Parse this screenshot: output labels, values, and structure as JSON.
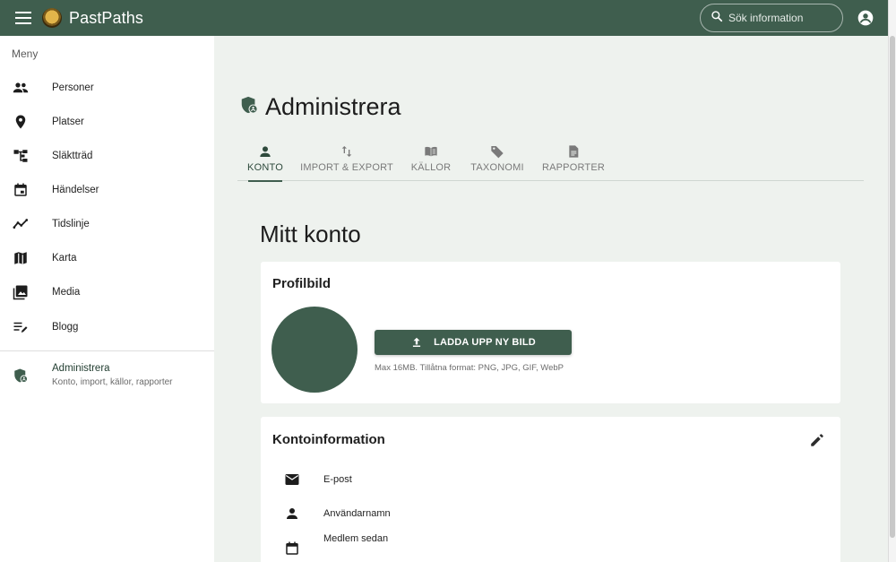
{
  "app": {
    "title": "PastPaths"
  },
  "search": {
    "placeholder": "Sök information"
  },
  "sidebar": {
    "heading": "Meny",
    "items": [
      {
        "label": "Personer",
        "icon": "people-icon"
      },
      {
        "label": "Platser",
        "icon": "location-pin-icon"
      },
      {
        "label": "Släktträd",
        "icon": "family-tree-icon"
      },
      {
        "label": "Händelser",
        "icon": "calendar-icon"
      },
      {
        "label": "Tidslinje",
        "icon": "timeline-icon"
      },
      {
        "label": "Karta",
        "icon": "map-icon"
      },
      {
        "label": "Media",
        "icon": "image-icon"
      },
      {
        "label": "Blogg",
        "icon": "edit-notes-icon"
      }
    ],
    "admin": {
      "label": "Administrera",
      "sublabel": "Konto, import, källor, rapporter",
      "icon": "admin-shield-icon"
    }
  },
  "page": {
    "title": "Administrera"
  },
  "tabs": [
    {
      "label": "KONTO",
      "icon": "person-icon",
      "active": true
    },
    {
      "label": "IMPORT & EXPORT",
      "icon": "import-export-icon",
      "active": false
    },
    {
      "label": "KÄLLOR",
      "icon": "book-icon",
      "active": false
    },
    {
      "label": "TAXONOMI",
      "icon": "tag-icon",
      "active": false
    },
    {
      "label": "RAPPORTER",
      "icon": "document-icon",
      "active": false
    }
  ],
  "account": {
    "title": "Mitt konto",
    "profile": {
      "title": "Profilbild",
      "upload_label": "LADDA UPP NY BILD",
      "hint": "Max 16MB. Tillåtna format: PNG, JPG, GIF, WebP"
    },
    "info": {
      "title": "Kontoinformation",
      "rows": [
        {
          "label": "E-post",
          "icon": "mail-icon"
        },
        {
          "label": "Användarnamn",
          "icon": "person-icon"
        },
        {
          "label": "Medlem sedan",
          "icon": "calendar-icon"
        }
      ]
    }
  },
  "colors": {
    "primary": "#3f5e4e",
    "background": "#eef2ee",
    "surface": "#ffffff"
  }
}
